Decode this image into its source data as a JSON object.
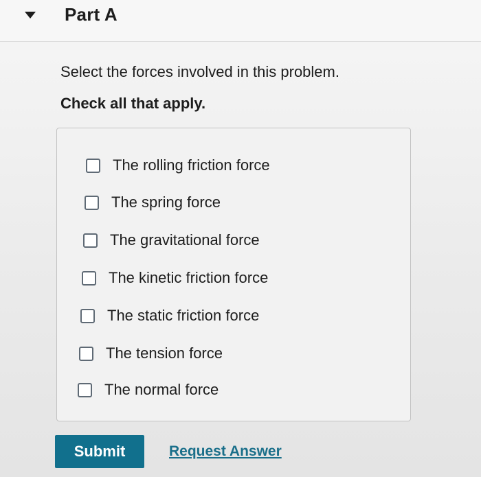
{
  "part": {
    "title": "Part A",
    "toggle_icon": "caret-down-icon"
  },
  "question": {
    "prompt": "Select the forces involved in this problem.",
    "instruction": "Check all that apply."
  },
  "options": [
    {
      "label": "The rolling friction force",
      "checked": false
    },
    {
      "label": "The spring force",
      "checked": false
    },
    {
      "label": "The gravitational force",
      "checked": false
    },
    {
      "label": "The kinetic friction force",
      "checked": false
    },
    {
      "label": "The static friction force",
      "checked": false
    },
    {
      "label": "The tension force",
      "checked": false
    },
    {
      "label": "The normal force",
      "checked": false
    }
  ],
  "actions": {
    "submit_label": "Submit",
    "request_answer_label": "Request Answer"
  },
  "colors": {
    "submit_background": "#11708d",
    "link": "#1a6f8a",
    "checkbox_border": "#5f6a75"
  }
}
